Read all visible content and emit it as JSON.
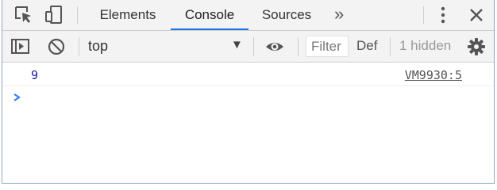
{
  "tabbar": {
    "tabs": [
      {
        "label": "Elements",
        "active": false
      },
      {
        "label": "Console",
        "active": true
      },
      {
        "label": "Sources",
        "active": false
      }
    ],
    "overflow_label": "»",
    "icons": [
      "inspect-element-icon",
      "device-toolbar-icon",
      "more-vertical-icon",
      "close-icon"
    ]
  },
  "toolbar": {
    "context": "top",
    "filter_placeholder": "Filter",
    "levels": "Def",
    "hidden_count": "1 hidden",
    "icons": [
      "sidebar-toggle-icon",
      "clear-console-icon",
      "dropdown-arrow-icon",
      "eye-icon",
      "settings-icon"
    ]
  },
  "console": {
    "messages": [
      {
        "value": "9",
        "source": "VM9930:5"
      }
    ],
    "prompt": ">"
  },
  "colors": {
    "accent": "#1a73e8",
    "number": "#1a1aa6",
    "prompt": "#367cf1",
    "toolbar_bg": "#f3f3f3"
  }
}
